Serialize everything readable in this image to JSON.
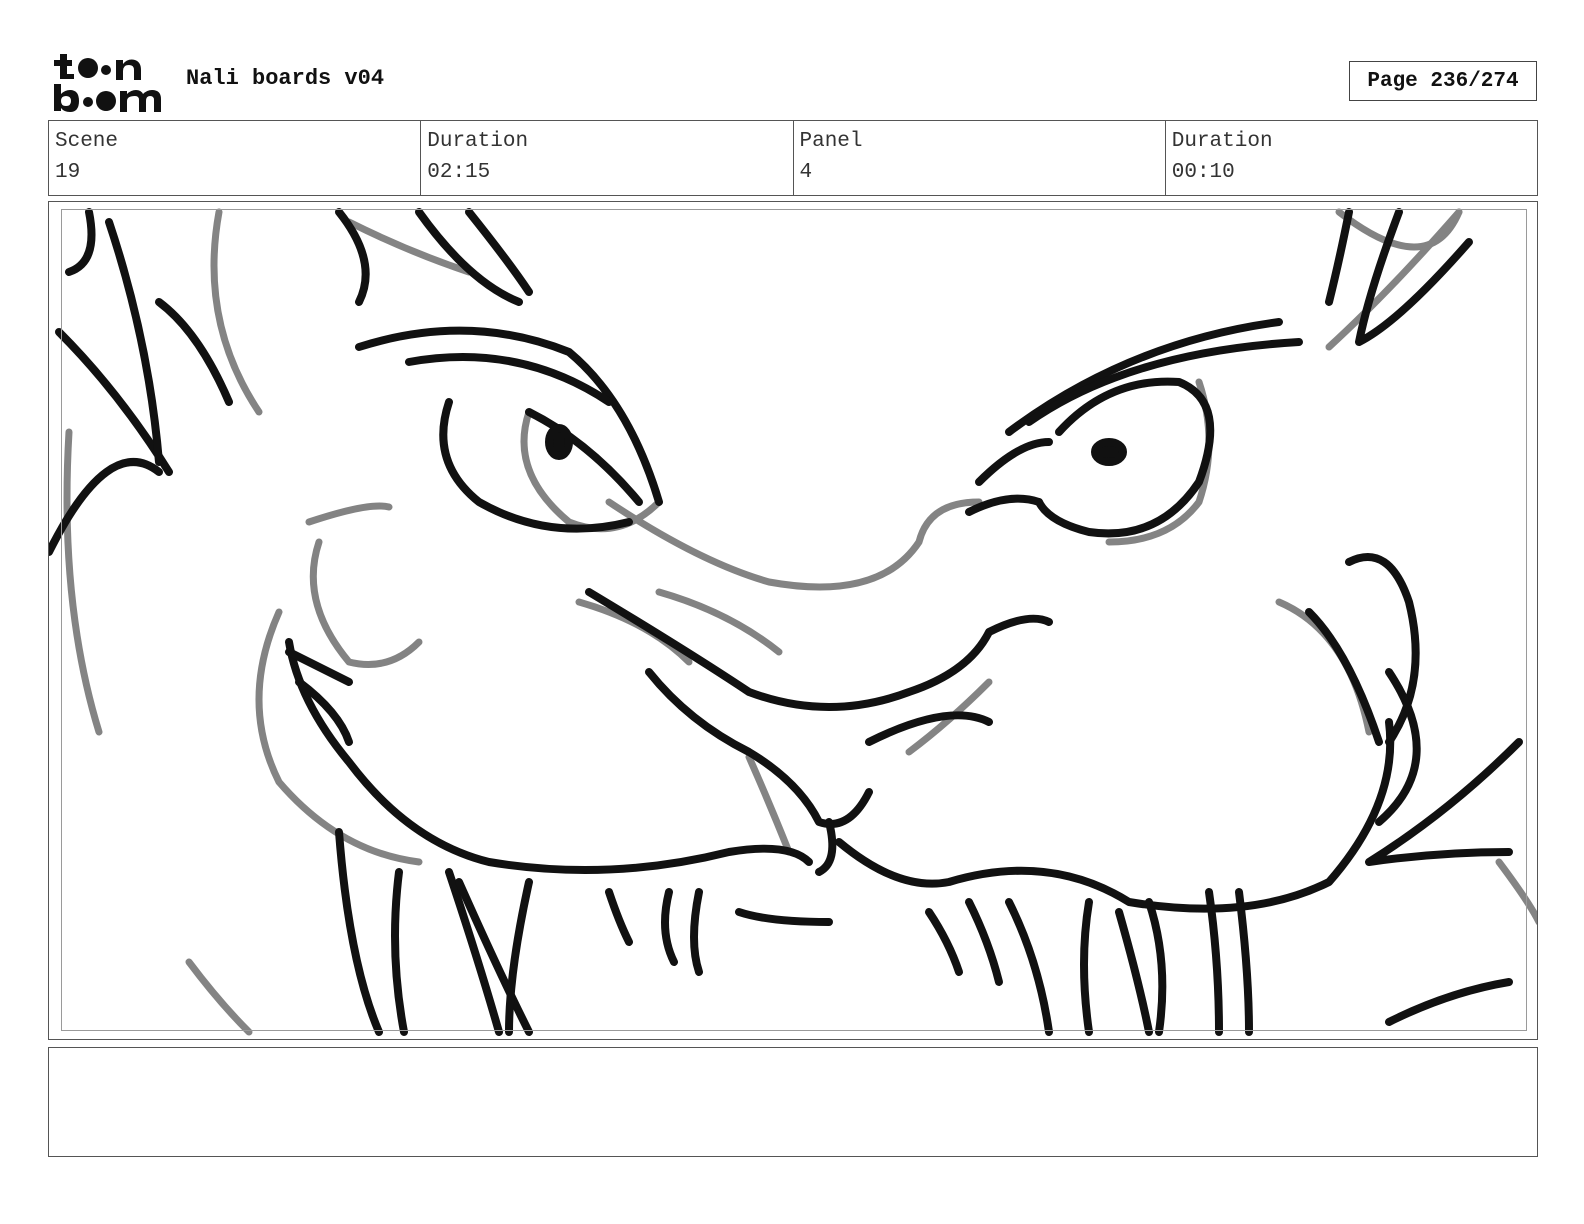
{
  "header": {
    "logo_alt": "toon boom",
    "project_title": "Nali boards v04",
    "page_label": "Page 236/274"
  },
  "info": {
    "scene_label": "Scene",
    "scene_value": "19",
    "scene_duration_label": "Duration",
    "scene_duration_value": "02:15",
    "panel_label": "Panel",
    "panel_value": "4",
    "panel_duration_label": "Duration",
    "panel_duration_value": "00:10"
  },
  "notes": {
    "text": ""
  }
}
